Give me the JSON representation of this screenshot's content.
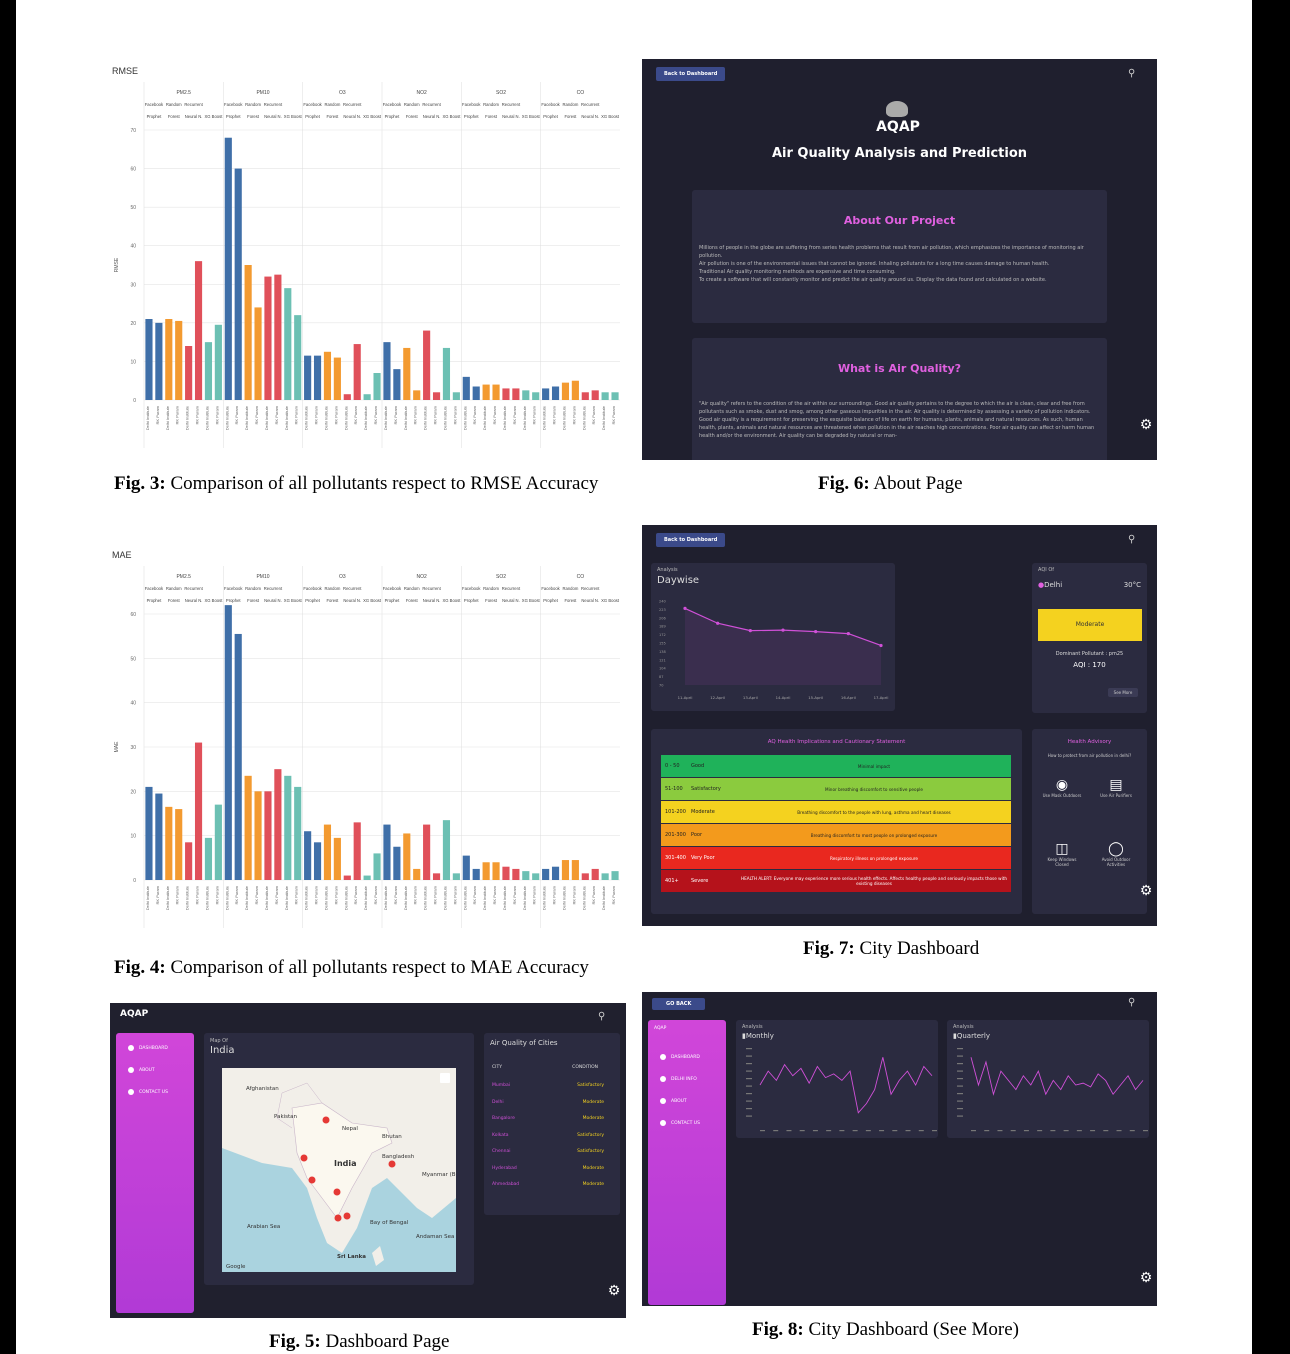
{
  "fig3": {
    "caption_prefix": "Fig. 3:",
    "caption_text": "Comparison of all pollutants respect to RMSE Accuracy",
    "chart_data": {
      "type": "bar",
      "title": "RMSE",
      "ylabel": "RMSE",
      "ylim": [
        0,
        70
      ],
      "yticks": [
        0,
        10,
        20,
        30,
        40,
        50,
        60,
        70
      ],
      "groups": [
        "PM2.5",
        "PM10",
        "O3",
        "NO2",
        "SO2",
        "CO"
      ],
      "models": [
        "Facebook Prophet",
        "Random Forest",
        "Recurrent Neural N.",
        "XG Boost"
      ],
      "model_top": [
        "Facebook",
        "Random",
        "Recurrent",
        ""
      ],
      "model_bottom": [
        "Prophet",
        "Forest",
        "Neural N.",
        "XG Boost"
      ],
      "stations": [
        "Delhi Institute",
        "RK Puram"
      ],
      "colors": [
        "#3f6fa8",
        "#f39a30",
        "#e0505a",
        "#6cc0b3"
      ],
      "values": [
        [
          21,
          20,
          21,
          20.5,
          14,
          36,
          15,
          19.5
        ],
        [
          68,
          60,
          35,
          24,
          32,
          32.5,
          29,
          22
        ],
        [
          11.5,
          11.5,
          12.5,
          11,
          1.5,
          14.5,
          1.5,
          7
        ],
        [
          15,
          8,
          13.5,
          2.5,
          18,
          2,
          13.5,
          2
        ],
        [
          6,
          3.5,
          4,
          4,
          3,
          3,
          2.5,
          2
        ],
        [
          3,
          3.5,
          4.5,
          5,
          2,
          2.5,
          2,
          2
        ]
      ]
    }
  },
  "fig4": {
    "caption_prefix": "Fig. 4:",
    "caption_text": "Comparison of all pollutants respect to MAE Accuracy",
    "chart_data": {
      "type": "bar",
      "title": "MAE",
      "ylabel": "MAE",
      "ylim": [
        0,
        60
      ],
      "yticks": [
        0,
        10,
        20,
        30,
        40,
        50,
        60
      ],
      "groups": [
        "PM2.5",
        "PM10",
        "O3",
        "NO2",
        "SO2",
        "CO"
      ],
      "models": [
        "Facebook Prophet",
        "Random Forest",
        "Recurrent Neural N.",
        "XG Boost"
      ],
      "model_top": [
        "Facebook",
        "Random",
        "Recurrent",
        ""
      ],
      "model_bottom": [
        "Prophet",
        "Forest",
        "Neural N.",
        "XG Boost"
      ],
      "stations": [
        "Delhi Institute",
        "RK Puram"
      ],
      "colors": [
        "#3f6fa8",
        "#f39a30",
        "#e0505a",
        "#6cc0b3"
      ],
      "values": [
        [
          21,
          19.5,
          16.5,
          16,
          8.5,
          31,
          9.5,
          17
        ],
        [
          62,
          55.5,
          23.5,
          20,
          20,
          25,
          23.5,
          21
        ],
        [
          11,
          8.5,
          12.5,
          9.5,
          1,
          13,
          1,
          6
        ],
        [
          12.5,
          7.5,
          10.5,
          2.5,
          12.5,
          1.5,
          13.5,
          1.5
        ],
        [
          5.5,
          2.5,
          4,
          4,
          3,
          2.5,
          2,
          1.5
        ],
        [
          2.5,
          3,
          4.5,
          4.5,
          1.5,
          2.5,
          1.5,
          2
        ]
      ]
    }
  },
  "fig5": {
    "caption_prefix": "Fig. 5:",
    "caption_text": "Dashboard Page",
    "brand": "AQAP",
    "sidebar": [
      "DASHBOARD",
      "ABOUT",
      "CONTACT US"
    ],
    "map_small_label": "Map Of",
    "map_title": "India",
    "map_labels": [
      "Afghanistan",
      "Pakistan",
      "Nepal",
      "Bhutan",
      "India",
      "Bangladesh",
      "Myanmar (Burma)",
      "Sri Lanka",
      "Arabian Sea",
      "Bay of Bengal",
      "Andaman Sea",
      "Google"
    ],
    "cities_title": "Air Quality of Cities",
    "col_city": "CITY",
    "col_condition": "CONDITION",
    "cities": [
      {
        "city": "Mumbai",
        "condition": "Satisfactory"
      },
      {
        "city": "Delhi",
        "condition": "Moderate"
      },
      {
        "city": "Bangalore",
        "condition": "Moderate"
      },
      {
        "city": "Kolkata",
        "condition": "Satisfactory"
      },
      {
        "city": "Chennai",
        "condition": "Satisfactory"
      },
      {
        "city": "Hyderabad",
        "condition": "Moderate"
      },
      {
        "city": "Ahmedabad",
        "condition": "Moderate"
      }
    ]
  },
  "fig6": {
    "caption_prefix": "Fig. 6:",
    "caption_text": "About Page",
    "back_button": "Back to Dashboard",
    "brand": "AQAP",
    "title": "Air Quality Analysis and Prediction",
    "about_title": "About Our Project",
    "about_lines": [
      "Millions of people in the globe are suffering from series health problems that result from air pollution, which emphasizes the importance of monitoring air pollution.",
      "Air pollution is one of the environmental issues that cannot be ignored. Inhaling pollutants for a long time causes damage to human health.",
      "Traditional Air quality monitoring methods are expensive and time consuming.",
      "To create a software that will constantly monitor and predict the air quality around us. Display the data found and calculated on a website."
    ],
    "aq_title": "What is Air Quality?",
    "aq_text": "\"Air quality\" refers to the condition of the air within our surroundings. Good air quality pertains to the degree to which the air is clean, clear and free from pollutants such as smoke, dust and smog, among other gaseous impurities in the air. Air quality is determined by assessing a variety of pollution indicators. Good air quality is a requirement for preserving the exquisite balance of life on earth for humans, plants, animals and natural resources. As such, human health, plants, animals and natural resources are threatened when pollution in the air reaches high concentrations. Poor air quality can affect or harm human health and/or the environment. Air quality can be degraded by natural or man-"
  },
  "fig7": {
    "caption_prefix": "Fig. 7:",
    "caption_text": "City Dashboard",
    "back_button": "Back to Dashboard",
    "analysis_small": "Analysis",
    "daywise": "Daywise",
    "daywise_chart": {
      "type": "line",
      "x": [
        "11-April",
        "12-April",
        "13-April",
        "14-April",
        "15-April",
        "16-April",
        "17-April"
      ],
      "values": [
        225,
        195,
        180,
        181,
        178,
        174,
        150
      ],
      "ylim": [
        70,
        240
      ]
    },
    "aqi_small": "AQI Of",
    "city": "Delhi",
    "temperature": "30°C",
    "status": "Moderate",
    "dominant": "Dominant Pollutant : pm25",
    "aqi_value": "AQI : 170",
    "see_more": "See More",
    "table_title": "AQ Health Implications and Cautionary Statement",
    "rows": [
      {
        "range": "0 - 50",
        "label": "Good",
        "text": "Minimal impact",
        "color": "#1fb25a"
      },
      {
        "range": "51-100",
        "label": "Satisfactory",
        "text": "Minor breathing discomfort to sensitive people",
        "color": "#8bcb3e"
      },
      {
        "range": "101-200",
        "label": "Moderate",
        "text": "Breathing discomfort to the people with lung, asthma and heart diseases",
        "color": "#f4d21f"
      },
      {
        "range": "201-300",
        "label": "Poor",
        "text": "Breathing discomfort to most people on prolonged exposure",
        "color": "#f39a1c"
      },
      {
        "range": "301-400",
        "label": "Very Poor",
        "text": "Respiratory illness on prolonged exposure",
        "color": "#e9281f"
      },
      {
        "range": "401+",
        "label": "Severe",
        "text": "HEALTH ALERT: Everyone may experience more serious health effects. Affects healthy people and seriously impacts those with existing diseases",
        "color": "#b5121b"
      }
    ],
    "advisory_title": "Health Advisory",
    "advisory_sub": "How to protect from air pollution in delhi?",
    "advice": [
      "Use Mask Outdoors",
      "Use Air Purifiers",
      "Keep Windows Closed",
      "Avoid Outdoor Activities"
    ]
  },
  "fig8": {
    "caption_prefix": "Fig. 8:",
    "caption_text": "City Dashboard (See More)",
    "go_back": "GO BACK",
    "brand": "AQAP",
    "sidebar": [
      "DASHBOARD",
      "DELHI INFO",
      "ABOUT",
      "CONTACT US"
    ],
    "analysis_small": "Analysis",
    "monthly": "Monthly",
    "quarterly": "Quarterly",
    "monthly_series": [
      40,
      55,
      45,
      62,
      50,
      58,
      42,
      60,
      48,
      52,
      45,
      55,
      10,
      20,
      35,
      70,
      30,
      45,
      55,
      40,
      60,
      50
    ],
    "quarterly_series": [
      70,
      40,
      65,
      30,
      55,
      45,
      35,
      50,
      40,
      55,
      30,
      45,
      35,
      50,
      40,
      42,
      38,
      52,
      45,
      30,
      40,
      50,
      35,
      45
    ]
  },
  "icons": {
    "gear": "gear-icon",
    "search": "search-icon",
    "pin": "map-pin-icon"
  }
}
